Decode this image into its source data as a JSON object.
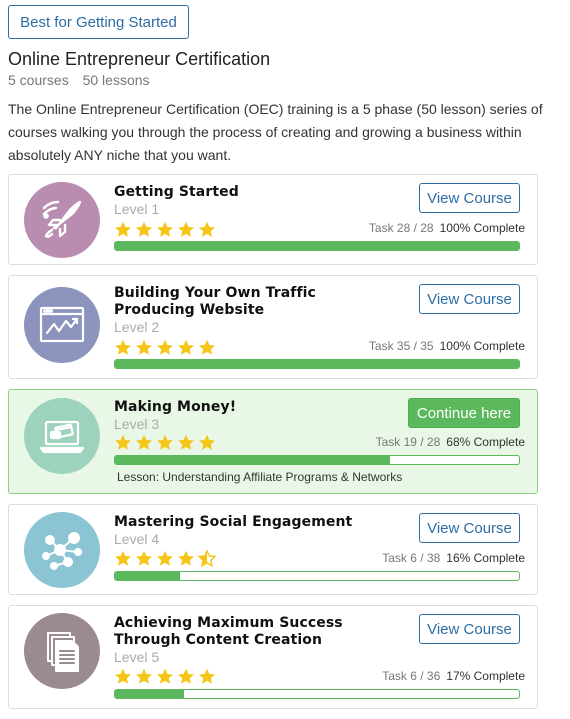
{
  "badge": "Best for Getting Started",
  "title": "Online Entrepreneur Certification",
  "meta": {
    "courses": "5 courses",
    "lessons": "50 lessons"
  },
  "description": "The Online Entrepreneur Certification (OEC) training is a 5 phase (50 lesson) series of courses walking you through the process of creating and growing a business within absolutely ANY niche that you want.",
  "colors": {
    "accent_blue": "#2e6da4",
    "progress_green": "#5cb85c",
    "star": "#f5c518",
    "active_bg": "#e9f8e6"
  },
  "courses": [
    {
      "title": "Getting Started",
      "level": "Level 1",
      "rating": 5,
      "task": "Task 28 / 28",
      "complete": "100% Complete",
      "progress": 1.0,
      "button": "View Course",
      "icon": "rocket-icon",
      "icon_color": "#b98db0"
    },
    {
      "title": "Building Your Own Traffic Producing Website",
      "level": "Level 2",
      "rating": 5,
      "task": "Task 35 / 35",
      "complete": "100% Complete",
      "progress": 1.0,
      "button": "View Course",
      "icon": "website-chart-icon",
      "icon_color": "#8c93bd"
    },
    {
      "title": "Making Money!",
      "level": "Level 3",
      "rating": 5,
      "task": "Task 19 / 28",
      "complete": "68% Complete",
      "progress": 0.68,
      "button": "Continue here",
      "lesson": "Lesson: Understanding Affiliate Programs & Networks",
      "icon": "laptop-payment-icon",
      "icon_color": "#9dd3bd"
    },
    {
      "title": "Mastering Social Engagement",
      "level": "Level 4",
      "rating": 4.5,
      "task": "Task 6 / 38",
      "complete": "16% Complete",
      "progress": 0.16,
      "button": "View Course",
      "icon": "social-network-icon",
      "icon_color": "#8bc4d3"
    },
    {
      "title": "Achieving Maximum Success Through Content Creation",
      "level": "Level 5",
      "rating": 5,
      "task": "Task 6 / 36",
      "complete": "17% Complete",
      "progress": 0.17,
      "button": "View Course",
      "icon": "documents-icon",
      "icon_color": "#9b8a90"
    }
  ]
}
